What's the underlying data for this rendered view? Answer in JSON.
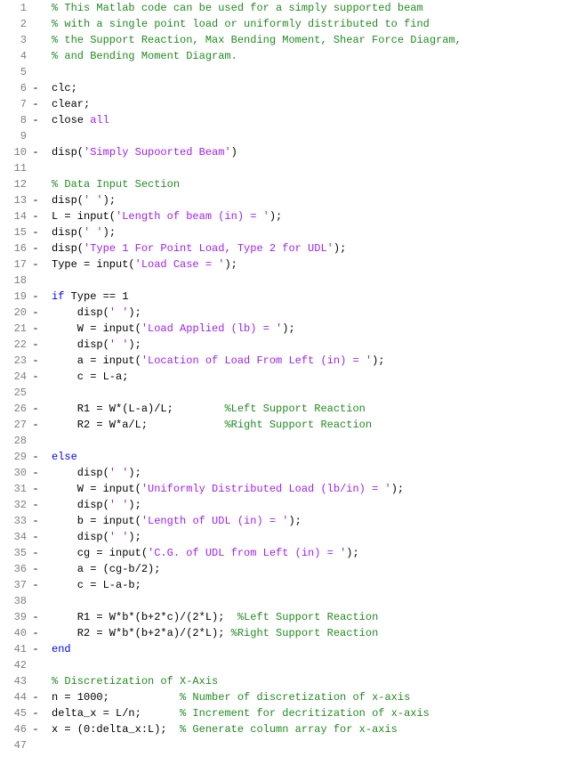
{
  "lines": [
    {
      "num": 1,
      "dash": "",
      "tokens": [
        {
          "cls": "comment",
          "t": "% This Matlab code can be used for a simply supported beam"
        }
      ]
    },
    {
      "num": 2,
      "dash": "",
      "tokens": [
        {
          "cls": "comment",
          "t": "% with a single point load or uniformly distributed to find"
        }
      ]
    },
    {
      "num": 3,
      "dash": "",
      "tokens": [
        {
          "cls": "comment",
          "t": "% the Support Reaction, Max Bending Moment, Shear Force Diagram,"
        }
      ]
    },
    {
      "num": 4,
      "dash": "",
      "tokens": [
        {
          "cls": "comment",
          "t": "% and Bending Moment Diagram."
        }
      ]
    },
    {
      "num": 5,
      "dash": "",
      "tokens": []
    },
    {
      "num": 6,
      "dash": "-",
      "tokens": [
        {
          "cls": "plain",
          "t": "clc;"
        }
      ]
    },
    {
      "num": 7,
      "dash": "-",
      "tokens": [
        {
          "cls": "plain",
          "t": "clear;"
        }
      ]
    },
    {
      "num": 8,
      "dash": "-",
      "tokens": [
        {
          "cls": "plain",
          "t": "close "
        },
        {
          "cls": "string",
          "t": "all"
        }
      ]
    },
    {
      "num": 9,
      "dash": "",
      "tokens": []
    },
    {
      "num": 10,
      "dash": "-",
      "tokens": [
        {
          "cls": "plain",
          "t": "disp("
        },
        {
          "cls": "string",
          "t": "'Simply Supoorted Beam'"
        },
        {
          "cls": "plain",
          "t": ")"
        }
      ]
    },
    {
      "num": 11,
      "dash": "",
      "tokens": []
    },
    {
      "num": 12,
      "dash": "",
      "tokens": [
        {
          "cls": "comment",
          "t": "% Data Input Section"
        }
      ]
    },
    {
      "num": 13,
      "dash": "-",
      "tokens": [
        {
          "cls": "plain",
          "t": "disp("
        },
        {
          "cls": "string",
          "t": "' '"
        },
        {
          "cls": "plain",
          "t": ");"
        }
      ]
    },
    {
      "num": 14,
      "dash": "-",
      "tokens": [
        {
          "cls": "plain",
          "t": "L = input("
        },
        {
          "cls": "string",
          "t": "'Length of beam (in) = '"
        },
        {
          "cls": "plain",
          "t": ");"
        }
      ]
    },
    {
      "num": 15,
      "dash": "-",
      "tokens": [
        {
          "cls": "plain",
          "t": "disp("
        },
        {
          "cls": "string",
          "t": "' '"
        },
        {
          "cls": "plain",
          "t": ");"
        }
      ]
    },
    {
      "num": 16,
      "dash": "-",
      "tokens": [
        {
          "cls": "plain",
          "t": "disp("
        },
        {
          "cls": "string",
          "t": "'Type 1 For Point Load, Type 2 for UDL'"
        },
        {
          "cls": "plain",
          "t": ");"
        }
      ]
    },
    {
      "num": 17,
      "dash": "-",
      "tokens": [
        {
          "cls": "plain",
          "t": "Type = input("
        },
        {
          "cls": "string",
          "t": "'Load Case = '"
        },
        {
          "cls": "plain",
          "t": ");"
        }
      ]
    },
    {
      "num": 18,
      "dash": "",
      "tokens": []
    },
    {
      "num": 19,
      "dash": "-",
      "tokens": [
        {
          "cls": "keyword",
          "t": "if"
        },
        {
          "cls": "plain",
          "t": " Type == 1"
        }
      ]
    },
    {
      "num": 20,
      "dash": "-",
      "tokens": [
        {
          "cls": "plain",
          "t": "    disp("
        },
        {
          "cls": "string",
          "t": "' '"
        },
        {
          "cls": "plain",
          "t": ");"
        }
      ]
    },
    {
      "num": 21,
      "dash": "-",
      "tokens": [
        {
          "cls": "plain",
          "t": "    W = input("
        },
        {
          "cls": "string",
          "t": "'Load Applied (lb) = '"
        },
        {
          "cls": "plain",
          "t": ");"
        }
      ]
    },
    {
      "num": 22,
      "dash": "-",
      "tokens": [
        {
          "cls": "plain",
          "t": "    disp("
        },
        {
          "cls": "string",
          "t": "' '"
        },
        {
          "cls": "plain",
          "t": ");"
        }
      ]
    },
    {
      "num": 23,
      "dash": "-",
      "tokens": [
        {
          "cls": "plain",
          "t": "    a = input("
        },
        {
          "cls": "string",
          "t": "'Location of Load From Left (in) = '"
        },
        {
          "cls": "plain",
          "t": ");"
        }
      ]
    },
    {
      "num": 24,
      "dash": "-",
      "tokens": [
        {
          "cls": "plain",
          "t": "    c = L-a;"
        }
      ]
    },
    {
      "num": 25,
      "dash": "",
      "tokens": []
    },
    {
      "num": 26,
      "dash": "-",
      "tokens": [
        {
          "cls": "plain",
          "t": "    R1 = W*(L-a)/L;        "
        },
        {
          "cls": "comment",
          "t": "%Left Support Reaction"
        }
      ]
    },
    {
      "num": 27,
      "dash": "-",
      "tokens": [
        {
          "cls": "plain",
          "t": "    R2 = W*a/L;            "
        },
        {
          "cls": "comment",
          "t": "%Right Support Reaction"
        }
      ]
    },
    {
      "num": 28,
      "dash": "",
      "tokens": []
    },
    {
      "num": 29,
      "dash": "-",
      "tokens": [
        {
          "cls": "keyword",
          "t": "else"
        }
      ]
    },
    {
      "num": 30,
      "dash": "-",
      "tokens": [
        {
          "cls": "plain",
          "t": "    disp("
        },
        {
          "cls": "string",
          "t": "' '"
        },
        {
          "cls": "plain",
          "t": ");"
        }
      ]
    },
    {
      "num": 31,
      "dash": "-",
      "tokens": [
        {
          "cls": "plain",
          "t": "    W = input("
        },
        {
          "cls": "string",
          "t": "'Uniformly Distributed Load (lb/in) = '"
        },
        {
          "cls": "plain",
          "t": ");"
        }
      ]
    },
    {
      "num": 32,
      "dash": "-",
      "tokens": [
        {
          "cls": "plain",
          "t": "    disp("
        },
        {
          "cls": "string",
          "t": "' '"
        },
        {
          "cls": "plain",
          "t": ");"
        }
      ]
    },
    {
      "num": 33,
      "dash": "-",
      "tokens": [
        {
          "cls": "plain",
          "t": "    b = input("
        },
        {
          "cls": "string",
          "t": "'Length of UDL (in) = '"
        },
        {
          "cls": "plain",
          "t": ");"
        }
      ]
    },
    {
      "num": 34,
      "dash": "-",
      "tokens": [
        {
          "cls": "plain",
          "t": "    disp("
        },
        {
          "cls": "string",
          "t": "' '"
        },
        {
          "cls": "plain",
          "t": ");"
        }
      ]
    },
    {
      "num": 35,
      "dash": "-",
      "tokens": [
        {
          "cls": "plain",
          "t": "    cg = input("
        },
        {
          "cls": "string",
          "t": "'C.G. of UDL from Left (in) = '"
        },
        {
          "cls": "plain",
          "t": ");"
        }
      ]
    },
    {
      "num": 36,
      "dash": "-",
      "tokens": [
        {
          "cls": "plain",
          "t": "    a = (cg-b/2);"
        }
      ]
    },
    {
      "num": 37,
      "dash": "-",
      "tokens": [
        {
          "cls": "plain",
          "t": "    c = L-a-b;"
        }
      ]
    },
    {
      "num": 38,
      "dash": "",
      "tokens": []
    },
    {
      "num": 39,
      "dash": "-",
      "tokens": [
        {
          "cls": "plain",
          "t": "    R1 = W*b*(b+2*c)/(2*L);  "
        },
        {
          "cls": "comment",
          "t": "%Left Support Reaction"
        }
      ]
    },
    {
      "num": 40,
      "dash": "-",
      "tokens": [
        {
          "cls": "plain",
          "t": "    R2 = W*b*(b+2*a)/(2*L); "
        },
        {
          "cls": "comment",
          "t": "%Right Support Reaction"
        }
      ]
    },
    {
      "num": 41,
      "dash": "-",
      "tokens": [
        {
          "cls": "keyword",
          "t": "end"
        }
      ]
    },
    {
      "num": 42,
      "dash": "",
      "tokens": []
    },
    {
      "num": 43,
      "dash": "",
      "tokens": [
        {
          "cls": "comment",
          "t": "% Discretization of X-Axis"
        }
      ]
    },
    {
      "num": 44,
      "dash": "-",
      "tokens": [
        {
          "cls": "plain",
          "t": "n = 1000;           "
        },
        {
          "cls": "comment",
          "t": "% Number of discretization of x-axis"
        }
      ]
    },
    {
      "num": 45,
      "dash": "-",
      "tokens": [
        {
          "cls": "plain",
          "t": "delta_x = L/n;      "
        },
        {
          "cls": "comment",
          "t": "% Increment for decritization of x-axis"
        }
      ]
    },
    {
      "num": 46,
      "dash": "-",
      "tokens": [
        {
          "cls": "plain",
          "t": "x = (0:delta_x:L);  "
        },
        {
          "cls": "comment",
          "t": "% Generate column array for x-axis"
        }
      ]
    },
    {
      "num": 47,
      "dash": "",
      "tokens": []
    }
  ]
}
